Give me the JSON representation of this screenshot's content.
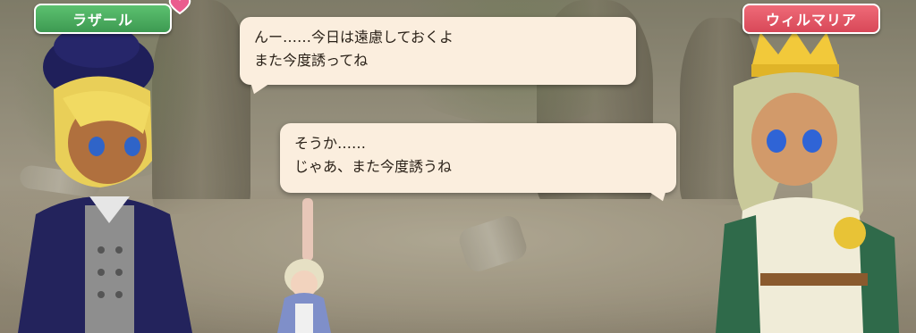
{
  "speakers": {
    "left_name": "ラザール",
    "right_name": "ウィルマリア"
  },
  "dialogue": {
    "bubble_top": {
      "line1": "んー……今日は遠慮しておくよ",
      "line2": "また今度誘ってね"
    },
    "bubble_bottom": {
      "line1": "そうか……",
      "line2": "じゃあ、また今度誘うね"
    }
  },
  "colors": {
    "left_tag": "#4caf5f",
    "right_tag": "#e25a68",
    "bubble": "#fbeede"
  },
  "icons": [
    "heart-icon"
  ]
}
